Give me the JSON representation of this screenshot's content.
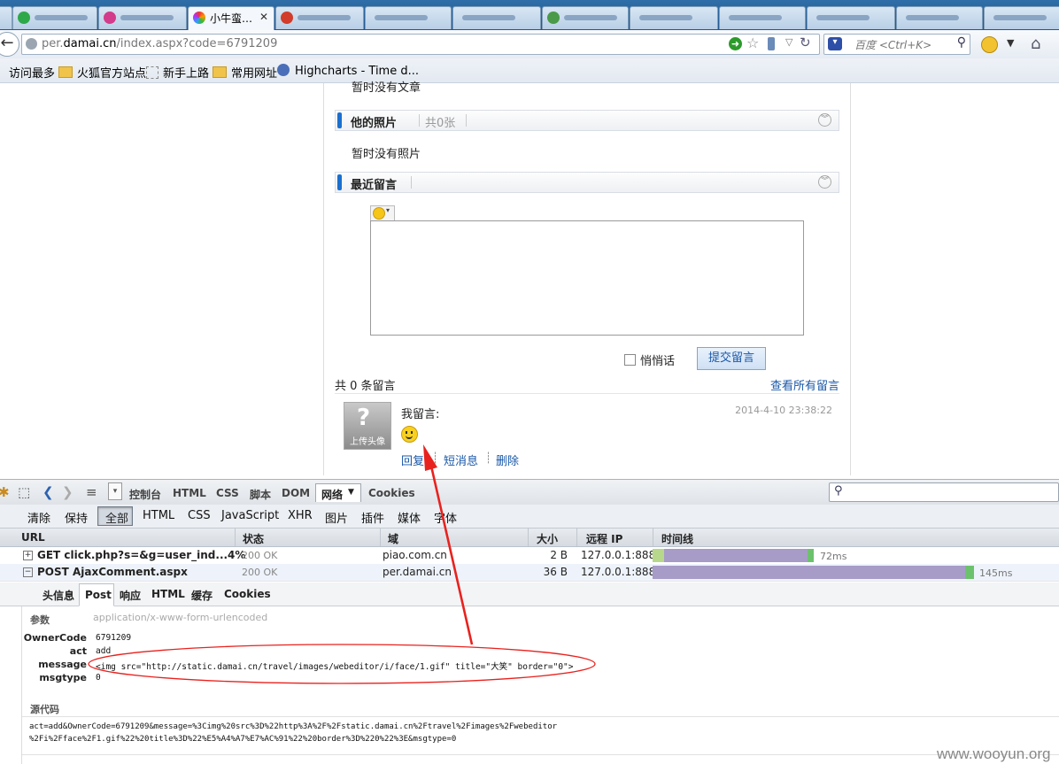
{
  "browser": {
    "tabs": [
      {
        "label": "",
        "favicon_color": "#2fa84a"
      },
      {
        "label": "",
        "favicon_color": "#d23c8a"
      },
      {
        "label": "小牛蛮…",
        "favicon_color": "#e8a020",
        "active": true
      },
      {
        "label": "",
        "favicon_color": "#d23c2a"
      },
      {
        "label": "",
        "favicon_color": "#7a9ac0"
      },
      {
        "label": "",
        "favicon_color": "#3a7ab8"
      },
      {
        "label": "",
        "favicon_color": "#4a9a4a"
      },
      {
        "label": "",
        "favicon_color": "#7a9ac0"
      },
      {
        "label": "",
        "favicon_color": "#7a9ac0"
      },
      {
        "label": "",
        "favicon_color": "#7a9ac0"
      },
      {
        "label": "",
        "favicon_color": "#7a9ac0"
      }
    ],
    "url_prefix": "per.",
    "url_domain": "damai.cn",
    "url_suffix": "/index.aspx?code=6791209",
    "search_placeholder": "百度 <Ctrl+K>",
    "bookmarks": [
      "访问最多",
      "火狐官方站点",
      "新手上路",
      "常用网址",
      "Highcharts - Time d..."
    ]
  },
  "page": {
    "top_cut_text": "暂时没有文章",
    "photos_title": "他的照片",
    "photos_count": "共0张",
    "no_photos": "暂时没有照片",
    "comments_title": "最近留言",
    "whisper_label": "悄悄话",
    "submit_label": "提交留言",
    "total_count": "共 0 条留言",
    "view_all": "查看所有留言",
    "avatar_caption": "上传头像",
    "comment_author": "我留言:",
    "comment_time": "2014-4-10 23:38:22",
    "reply_link": "回复",
    "sms_link": "短消息",
    "delete_link": "删除"
  },
  "firebug": {
    "panel_tabs": [
      "控制台",
      "HTML",
      "CSS",
      "脚本",
      "DOM",
      "网络",
      "Cookies"
    ],
    "active_panel": "网络",
    "toolbar2": [
      "清除",
      "保持",
      "全部",
      "HTML",
      "CSS",
      "JavaScript",
      "XHR",
      "图片",
      "插件",
      "媒体",
      "字体"
    ],
    "active_filter": "全部",
    "columns": [
      "URL",
      "状态",
      "域",
      "大小",
      "远程 IP",
      "时间线"
    ],
    "requests": [
      {
        "toggle": "+",
        "url": "GET click.php?s=&g=user_ind...4%",
        "status": "200 OK",
        "domain": "piao.com.cn",
        "size": "2 B",
        "ip": "127.0.0.1:8888",
        "time": "72ms"
      },
      {
        "toggle": "−",
        "url": "POST AjaxComment.aspx",
        "status": "200 OK",
        "domain": "per.damai.cn",
        "size": "36 B",
        "ip": "127.0.0.1:8888",
        "time": "145ms"
      }
    ],
    "detail_tabs": [
      "头信息",
      "Post",
      "响应",
      "HTML",
      "缓存",
      "Cookies"
    ],
    "active_detail": "Post",
    "params_label": "参数",
    "content_type": "application/x-www-form-urlencoded",
    "params": [
      {
        "key": "OwnerCode",
        "value": "6791209"
      },
      {
        "key": "act",
        "value": "add"
      },
      {
        "key": "message",
        "value": "<img src=\"http://static.damai.cn/travel/images/webeditor/i/face/1.gif\" title=\"大笑\" border=\"0\">"
      },
      {
        "key": "msgtype",
        "value": "0"
      }
    ],
    "source_label": "源代码",
    "source_lines": [
      "act=add&OwnerCode=6791209&message=%3Cimg%20src%3D%22http%3A%2F%2Fstatic.damai.cn%2Ftravel%2Fimages%2Fwebeditor",
      "%2Fi%2Fface%2F1.gif%22%20title%3D%22%E5%A4%A7%E7%AC%91%22%20border%3D%220%22%3E&msgtype=0"
    ]
  },
  "watermark": "www.wooyun.org",
  "colors": {
    "accent": "#1a58a8",
    "annotation": "#e8221e",
    "timeline_wait": "#a79bc8",
    "timeline_recv": "#6cc26c"
  }
}
